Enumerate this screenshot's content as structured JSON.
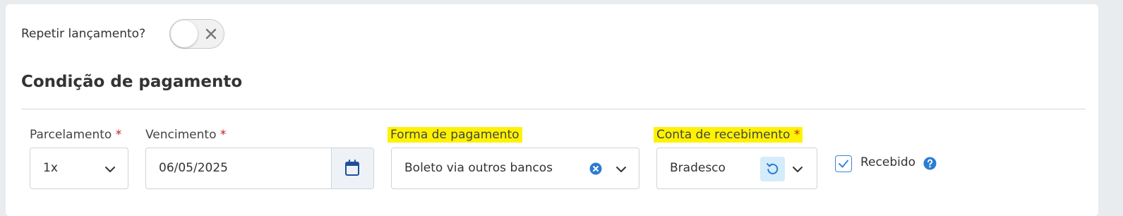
{
  "repeat": {
    "label": "Repetir lançamento?",
    "enabled": false
  },
  "section": {
    "title": "Condição de pagamento"
  },
  "fields": {
    "parcelamento": {
      "label": "Parcelamento",
      "required": "*",
      "value": "1x"
    },
    "vencimento": {
      "label": "Vencimento",
      "required": "*",
      "value": "06/05/2025"
    },
    "forma_pagamento": {
      "label": "Forma de pagamento",
      "value": "Boleto via outros bancos"
    },
    "conta_recebimento": {
      "label": "Conta de recebimento",
      "required": "*",
      "value": "Bradesco"
    },
    "recebido": {
      "label": "Recebido",
      "checked": true
    }
  },
  "icons": {
    "toggle": "close-icon",
    "date": "calendar-icon",
    "clear": "clear-icon",
    "reset": "reset-icon",
    "dropdown": "chevron-down-icon",
    "help": "help-icon"
  },
  "colors": {
    "highlight": "#fff200",
    "required": "#c11c1c",
    "accent": "#2b7cd3",
    "calendar": "#1f4e9c"
  }
}
